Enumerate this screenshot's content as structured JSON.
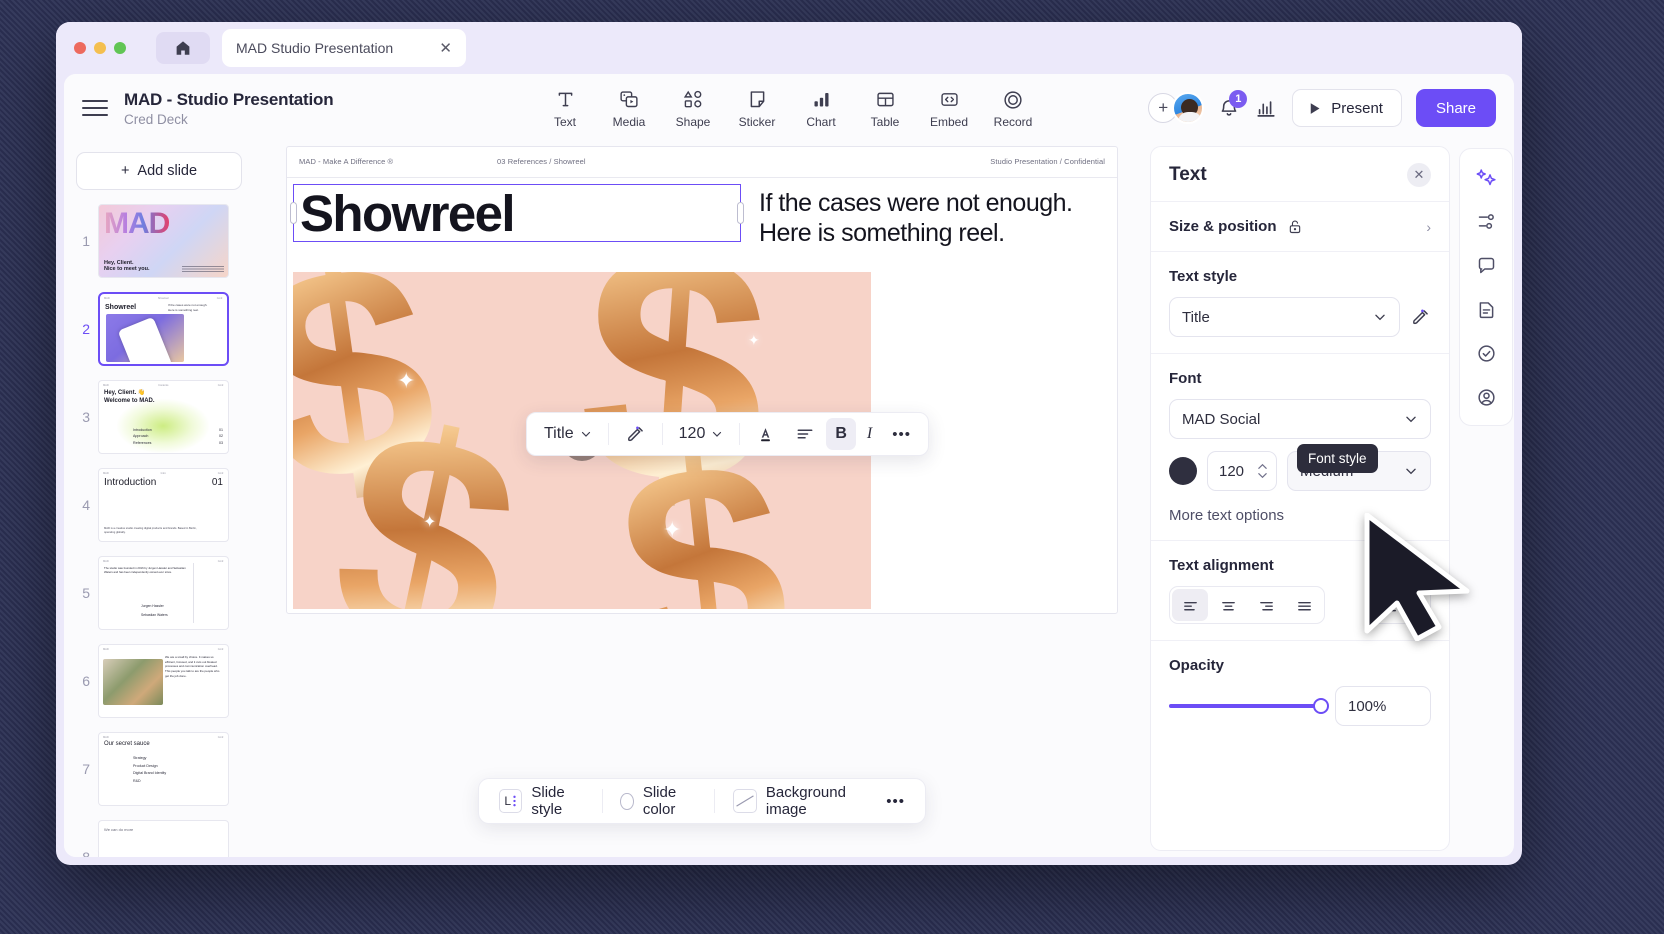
{
  "browser": {
    "tab_title": "MAD Studio Presentation",
    "close_label": "✕",
    "home_icon": "home-icon"
  },
  "header": {
    "doc_title": "MAD - Studio Presentation",
    "doc_subtitle": "Cred Deck",
    "tools": [
      {
        "label": "Text",
        "icon": "text-icon"
      },
      {
        "label": "Media",
        "icon": "media-icon"
      },
      {
        "label": "Shape",
        "icon": "shape-icon"
      },
      {
        "label": "Sticker",
        "icon": "sticker-icon"
      },
      {
        "label": "Chart",
        "icon": "chart-icon"
      },
      {
        "label": "Table",
        "icon": "table-icon"
      },
      {
        "label": "Embed",
        "icon": "embed-icon"
      },
      {
        "label": "Record",
        "icon": "record-icon"
      }
    ],
    "add_collaborator": "+",
    "notification_count": "1",
    "present_label": "Present",
    "share_label": "Share"
  },
  "slides_pane": {
    "add_slide_label": "Add slide",
    "add_slide_plus": "+",
    "slides": [
      {
        "num": "1",
        "title": "MAD",
        "line1": "Hey, Client.",
        "line2": "Nice to meet you.",
        "active": false
      },
      {
        "num": "2",
        "title": "Showreel",
        "sub1": "If the cases were not enough.",
        "sub2": "Here is something reel.",
        "active": true
      },
      {
        "num": "3",
        "title": "Hey, Client. 👋",
        "title2": "Welcome to MAD.",
        "toc": [
          [
            "Introduction",
            "01"
          ],
          [
            "Approach",
            "02"
          ],
          [
            "References",
            "03"
          ]
        ],
        "active": false
      },
      {
        "num": "4",
        "title": "Introduction",
        "index": "01",
        "body": "MAD is a creative studio creating digital products and brands. Based in Berlin, operating globally.",
        "active": false
      },
      {
        "num": "5",
        "body": "The studio was founded in 2016 by Jurgen Hassler and Sebastian Waters and has been independently owned ever since.",
        "names": [
          "Jurgen Hassler",
          "Sebastian Waters"
        ],
        "active": false
      },
      {
        "num": "6",
        "body": "We are a small by choice. It makes us efficient, focused, and it cuts out bloated processes and communication overhead. This people you talk to are the people who get the job done.",
        "active": false
      },
      {
        "num": "7",
        "title": "Our secret sauce",
        "list": [
          "Strategy",
          "Product Design",
          "Digital Brand Identity",
          "R&D"
        ],
        "active": false
      },
      {
        "num": "8",
        "title": "We can do more",
        "active": false
      }
    ]
  },
  "slide": {
    "header_left": "MAD - Make A Difference ®",
    "header_mid": "03 References / Showreel",
    "header_right": "Studio Presentation / Confidential",
    "title": "Showreel",
    "subtitle_line1": "If the cases were not enough.",
    "subtitle_line2": "Here is something reel.",
    "play_icon": "play-icon"
  },
  "format_toolbar": {
    "style_value": "Title",
    "brush_icon": "format-painter-icon",
    "font_size": "120",
    "text_color_icon": "text-color-icon",
    "line_spacing_icon": "line-spacing-icon",
    "bold_label": "B",
    "italic_label": "I",
    "more_label": "•••"
  },
  "slide_style_bar": {
    "style_badge": "L",
    "slide_style_label": "Slide style",
    "slide_color_label": "Slide color",
    "background_image_label": "Background image",
    "more_label": "•••"
  },
  "properties": {
    "title": "Text",
    "close_icon": "close-icon",
    "size_position_label": "Size & position",
    "lock_icon": "unlock-icon",
    "chevron_right": "›",
    "text_style_label": "Text style",
    "text_style_value": "Title",
    "text_style_brush_icon": "format-painter-icon",
    "font_label": "Font",
    "font_family": "MAD Social",
    "font_color": "#2f2f3f",
    "font_size": "120",
    "font_weight": "Medium",
    "more_text_options": "More text options",
    "text_alignment_label": "Text alignment",
    "align_options": [
      "align-left",
      "align-center",
      "align-right",
      "align-justify"
    ],
    "align_selected": "align-left",
    "vertical_align_icon": "vertical-align-bottom-icon",
    "opacity_label": "Opacity",
    "opacity_value": "100%",
    "opacity_percent": 100,
    "tooltip": "Font style"
  },
  "icon_rail": [
    {
      "name": "ai-magic-icon",
      "active": true
    },
    {
      "name": "animation-icon",
      "active": false
    },
    {
      "name": "comment-icon",
      "active": false
    },
    {
      "name": "notes-icon",
      "active": false
    },
    {
      "name": "checklist-icon",
      "active": false
    },
    {
      "name": "account-icon",
      "active": false
    }
  ],
  "colors": {
    "accent": "#6c4df6",
    "chrome_bg": "#ece9fa",
    "canvas_bg": "#fbfbfd",
    "media_bg": "#f7d3c8"
  }
}
